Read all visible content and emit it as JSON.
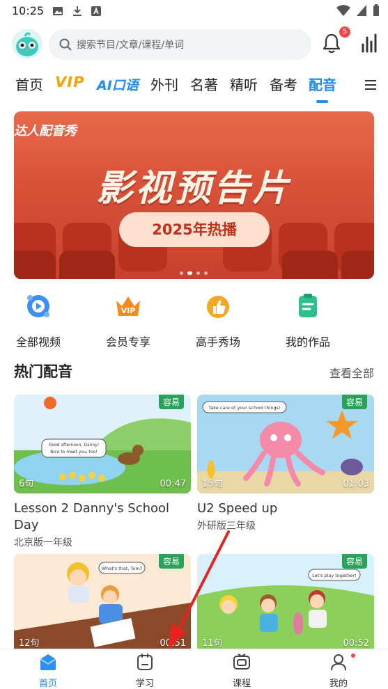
{
  "status_bar": {
    "time": "10:25"
  },
  "header": {
    "search_placeholder": "搜索节目/文章/课程/单词",
    "notification_count": "5"
  },
  "tabs": [
    {
      "label": "首页"
    },
    {
      "label": "VIP"
    },
    {
      "label": "AI口语"
    },
    {
      "label": "外刊"
    },
    {
      "label": "名著"
    },
    {
      "label": "精听"
    },
    {
      "label": "备考"
    },
    {
      "label": "配音",
      "active": true
    }
  ],
  "banner": {
    "tagline": "达人配音秀",
    "headline": "影视预告片",
    "pill": "2025年热播",
    "slide_index": 2,
    "slide_count": 4
  },
  "quick_entries": [
    {
      "label": "全部视频",
      "icon": "video-icon"
    },
    {
      "label": "会员专享",
      "icon": "vip-crown-icon"
    },
    {
      "label": "高手秀场",
      "icon": "thumbs-up-icon"
    },
    {
      "label": "我的作品",
      "icon": "works-icon"
    }
  ],
  "section": {
    "title": "热门配音",
    "view_all": "查看全部"
  },
  "cards": [
    {
      "title": "Lesson 2 Danny's School Day",
      "subtitle": "北京版一年级",
      "difficulty": "容易",
      "sentences": "6句",
      "duration": "00:47",
      "bubble": "Good afternoon, Danny! Nice to meet you, too!"
    },
    {
      "title": "U2 Speed up",
      "subtitle": "外研版三年级",
      "difficulty": "容易",
      "sentences": "15句",
      "duration": "01:03",
      "bubble": "Take care of your school things!"
    },
    {
      "title": "",
      "subtitle": "",
      "difficulty": "容易",
      "sentences": "12句",
      "duration": "00:51",
      "bubble": "What's that, Tom?"
    },
    {
      "title": "",
      "subtitle": "",
      "difficulty": "容易",
      "sentences": "11句",
      "duration": "00:52",
      "bubble": "Let's play together!"
    }
  ],
  "bottom_nav": [
    {
      "label": "首页",
      "active": true
    },
    {
      "label": "学习"
    },
    {
      "label": "课程"
    },
    {
      "label": "我的"
    }
  ],
  "colors": {
    "accent": "#1a8cf0",
    "vip": "#f5a300",
    "easy_badge": "#2aa35a",
    "banner": "#d9533a"
  }
}
